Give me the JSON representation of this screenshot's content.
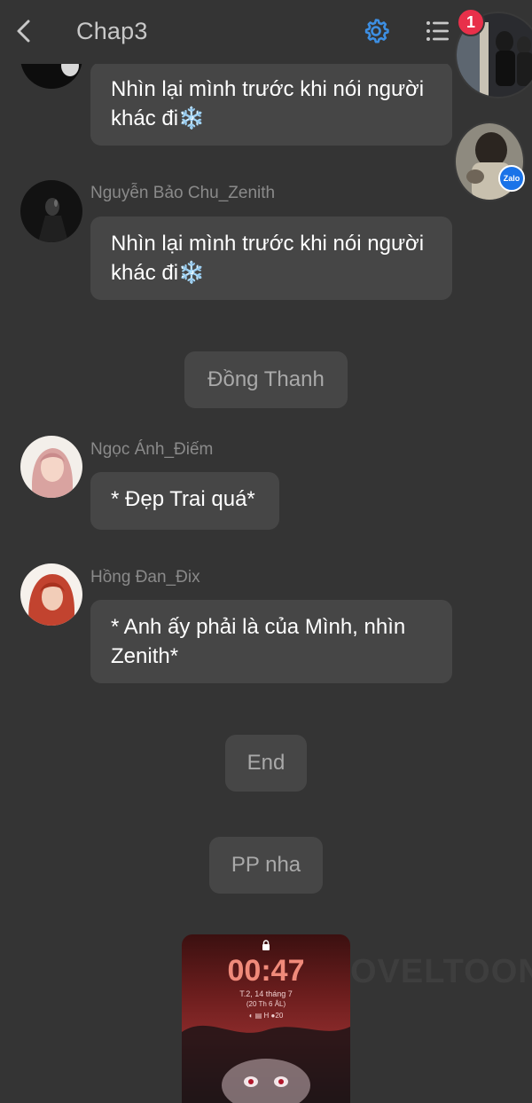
{
  "header": {
    "title": "Chap3",
    "badge_count": "1",
    "floating_chat_badge": "Zalo"
  },
  "messages": [
    {
      "sender": "",
      "text": "Nhìn lại mình trước khi nói người khác đi❄️"
    },
    {
      "sender": "Nguyễn Bảo Chu_Zenith",
      "text": "Nhìn lại mình trước khi nói người khác đi❄️"
    },
    {
      "narration": "Đồng Thanh"
    },
    {
      "sender": "Ngọc Ánh_Điếm",
      "text": "* Đẹp Trai quá*"
    },
    {
      "sender": "Hồng Đan_Đix",
      "text": "* Anh ấy phải là của Mình, nhìn Zenith*"
    },
    {
      "narration": "End"
    },
    {
      "narration": "PP nha"
    }
  ],
  "lockscreen": {
    "time": "00:47",
    "date": "T.2, 14 tháng 7",
    "lunar": "(20 Th 6 ÂL)",
    "status": "◐ ▤ H ●20"
  },
  "watermark": "OVELTOON",
  "colors": {
    "background": "#343434",
    "bubble": "#464646",
    "accent_gear": "#3d8fe3",
    "badge": "#e8304a"
  }
}
